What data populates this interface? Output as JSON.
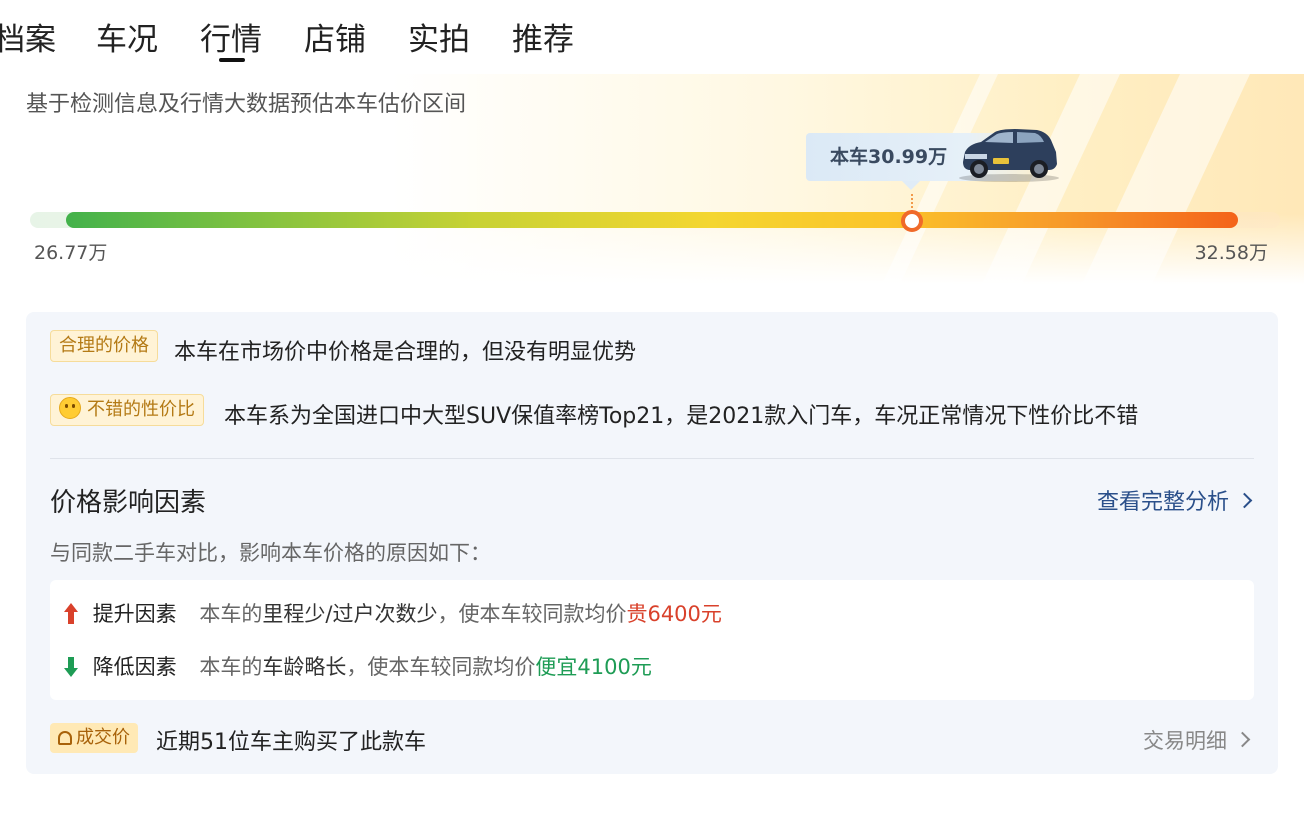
{
  "tabs": [
    {
      "label": "档案"
    },
    {
      "label": "车况"
    },
    {
      "label": "行情",
      "active": true
    },
    {
      "label": "店铺"
    },
    {
      "label": "实拍"
    },
    {
      "label": "推荐"
    }
  ],
  "estimate": {
    "subtitle": "基于检测信息及行情大数据预估本车估价区间",
    "car_price_label": "本车30.99万",
    "range_min": "26.77万",
    "range_max": "32.58万",
    "car_price_position_fraction": 0.75
  },
  "analysis": {
    "reasonable_badge": "合理的价格",
    "reasonable_text": "本车在市场价中价格是合理的，但没有明显优势",
    "value_badge": "不错的性价比",
    "value_text": "本车系为全国进口中大型SUV保值率榜Top21，是2021款入门车，车况正常情况下性价比不错"
  },
  "factors": {
    "title": "价格影响因素",
    "link": "查看完整分析",
    "subtitle": "与同款二手车对比，影响本车价格的原因如下：",
    "up": {
      "label": "提升因素",
      "prefix": "本车的",
      "highlight": "里程少/过户次数少",
      "middle": "，使本车较同款均价",
      "result": "贵6400元"
    },
    "down": {
      "label": "降低因素",
      "prefix": "本车的",
      "highlight": "车龄略长",
      "middle": "，使本车较同款均价",
      "result": "便宜4100元"
    }
  },
  "deal": {
    "badge": "成交价",
    "text": "近期51位车主购买了此款车",
    "link": "交易明细"
  },
  "colors": {
    "accent_orange": "#f06a2a",
    "up_red": "#d9412b",
    "down_green": "#1e9c55",
    "link_blue": "#2a4f8a"
  }
}
